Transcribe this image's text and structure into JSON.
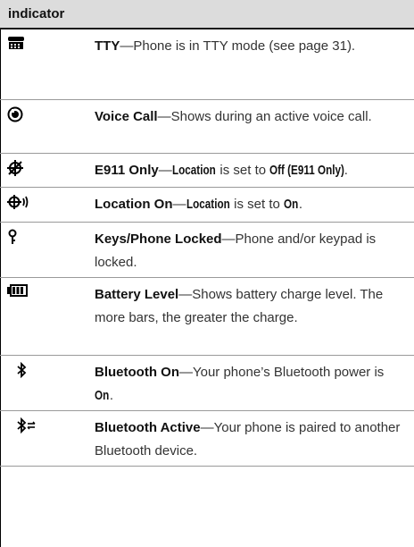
{
  "header": {
    "title": "indicator"
  },
  "rows": [
    {
      "icon": "tty-icon",
      "title": "TTY",
      "desc": "Phone is in TTY mode (see page 31)."
    },
    {
      "icon": "voice-call-icon",
      "title": "Voice Call",
      "desc": "Shows during an active voice call."
    },
    {
      "icon": "e911-only-icon",
      "title": "E911 Only",
      "desc_parts": {
        "setting": "Location",
        "mid": " is set to ",
        "value": "Off (E911 Only)",
        "end": "."
      }
    },
    {
      "icon": "location-on-icon",
      "title": "Location On",
      "desc_parts": {
        "setting": "Location",
        "mid": " is set to ",
        "value": "On",
        "end": "."
      }
    },
    {
      "icon": "keys-locked-icon",
      "title": "Keys/Phone Locked",
      "desc": "Phone and/or keypad is locked."
    },
    {
      "icon": "battery-level-icon",
      "title": "Battery Level",
      "desc": "Shows battery charge level. The more bars, the greater the charge."
    },
    {
      "icon": "bluetooth-on-icon",
      "title": "Bluetooth On",
      "desc_parts": {
        "pre": "Your phone’s Bluetooth power is ",
        "value": "On",
        "end": "."
      }
    },
    {
      "icon": "bluetooth-active-icon",
      "title": "Bluetooth Active",
      "desc": "Your phone is paired to another Bluetooth device."
    }
  ],
  "dash": "—"
}
